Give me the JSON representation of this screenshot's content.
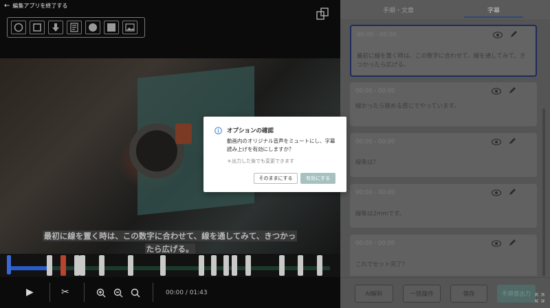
{
  "editor": {
    "exit_label": "編集アプリを終了する",
    "caption_line1": "最初に線を置く時は、この数字に合わせて、線を通してみて、きつかっ",
    "caption_line2": "たら広げる。",
    "time": "00:00 / 01:43",
    "tools": [
      "circle-tool-icon",
      "square-tool-icon",
      "arrow-down-tool-icon",
      "text-tool-icon",
      "filled-circle-tool-icon",
      "filled-square-tool-icon",
      "image-tool-icon"
    ]
  },
  "sidebar": {
    "tabs": [
      "手順・文章",
      "字幕"
    ],
    "cards": [
      {
        "ts": "00:00 - 00:00",
        "text": "最初に線を置く時は、この数字に合わせて、線を通してみて、きつかったら広げる。"
      },
      {
        "ts": "00:00 - 00:00",
        "text": "線かったら狭める感じでやっています。"
      },
      {
        "ts": "00:00 - 00:00",
        "text": "線象は？"
      },
      {
        "ts": "00:00 - 00:00",
        "text": "線象は2mmです。"
      },
      {
        "ts": "00:00 - 00:00",
        "text": "これでセット完了？"
      }
    ],
    "footer": {
      "ai_label": "AI解析",
      "bulk_label": "一括操作",
      "save_label": "保存",
      "export_label": "手順書出力"
    }
  },
  "dialog": {
    "title": "オプションの確認",
    "body": "動画内のオリジナル音声をミュートにし、字幕読み上げを有効にしますか？",
    "note": "＊出力した後でも変更できます",
    "keep_label": "そのままにする",
    "enable_label": "有効にする"
  }
}
